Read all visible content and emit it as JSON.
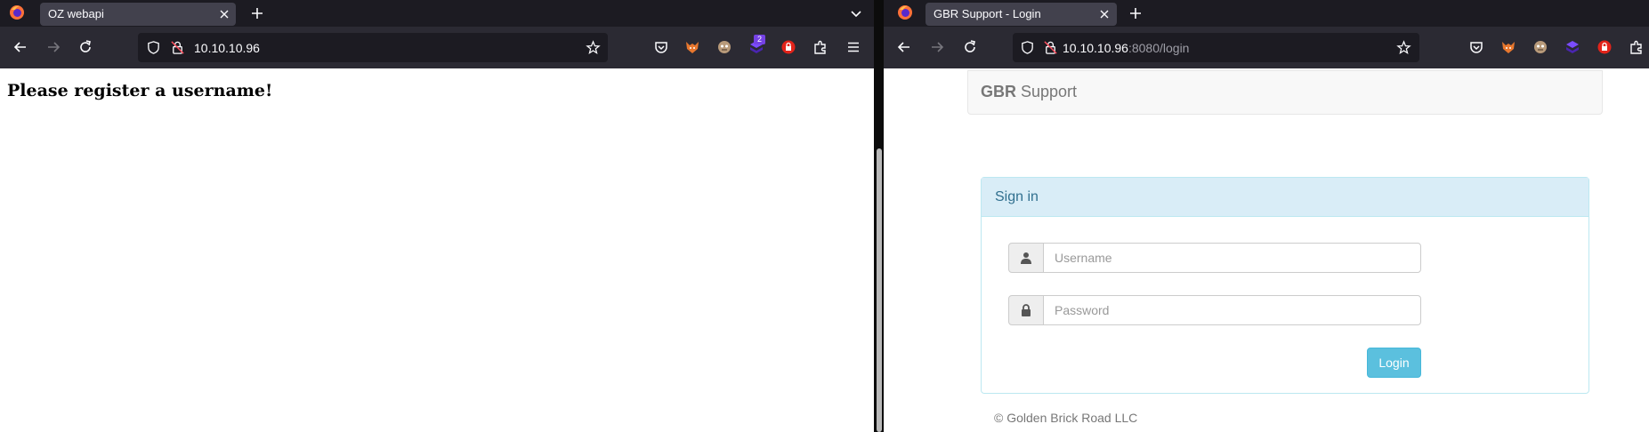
{
  "left_window": {
    "tab_title": "OZ webapi",
    "url": "10.10.10.96",
    "extension_badge": "2",
    "page": {
      "heading": "Please register a username!"
    }
  },
  "right_window": {
    "tab_title": "GBR Support - Login",
    "url_host": "10.10.10.96",
    "url_path": ":8080/login",
    "page": {
      "brand_bold": "GBR",
      "brand_rest": " Support",
      "panel_title": "Sign in",
      "username_placeholder": "Username",
      "password_placeholder": "Password",
      "login_label": "Login",
      "footer": "© Golden Brick Road LLC"
    }
  },
  "icons": [
    "firefox-logo-icon",
    "close-icon",
    "plus-icon",
    "chevron-down-icon",
    "back-arrow-icon",
    "forward-arrow-icon",
    "reload-icon",
    "shield-icon",
    "lock-slash-icon",
    "star-icon",
    "pocket-icon",
    "foxyproxy-icon",
    "cookie-editor-icon",
    "wappalyzer-icon",
    "ublock-icon",
    "extensions-icon",
    "hamburger-menu-icon",
    "user-icon",
    "lock-icon"
  ],
  "colors": {
    "tabbar": "#1c1b22",
    "toolbar": "#2b2a33",
    "active_tab": "#42414d",
    "panel_heading_bg": "#d9edf7",
    "panel_heading_text": "#31708f",
    "login_button": "#5bc0de"
  }
}
